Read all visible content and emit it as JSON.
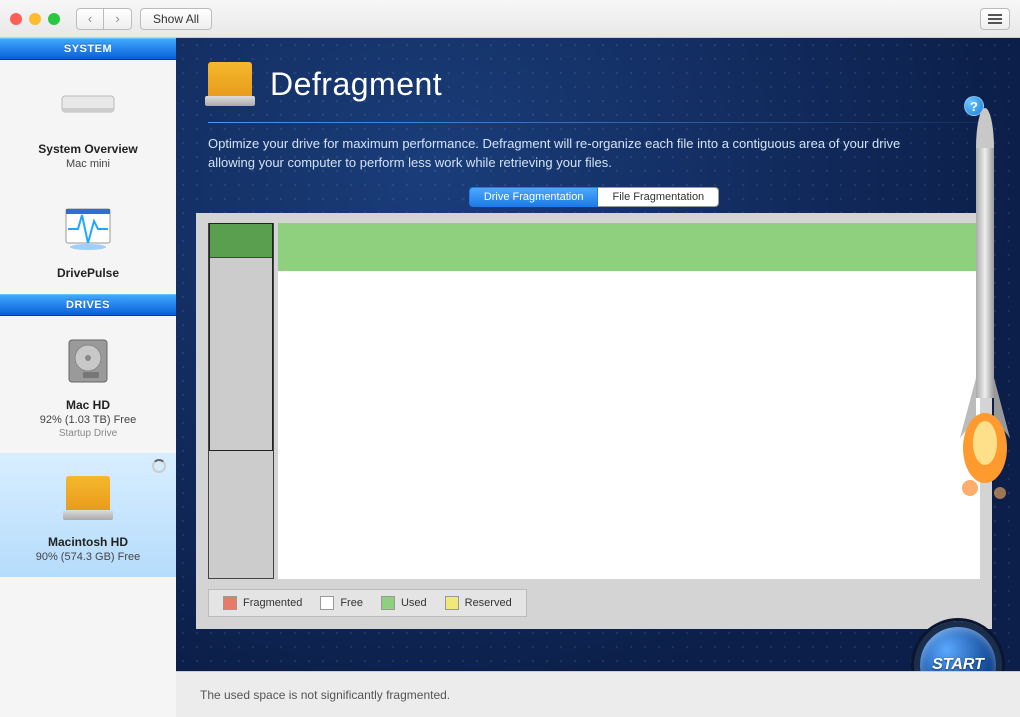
{
  "toolbar": {
    "show_all": "Show All"
  },
  "sidebar": {
    "sections": {
      "system": {
        "header": "SYSTEM"
      },
      "drives": {
        "header": "DRIVES"
      }
    },
    "items": [
      {
        "title": "System Overview",
        "sub": "Mac mini"
      },
      {
        "title": "DrivePulse",
        "sub": ""
      },
      {
        "title": "Mac HD",
        "sub": "92% (1.03 TB) Free",
        "sub2": "Startup Drive"
      },
      {
        "title": "Macintosh HD",
        "sub": "90% (574.3 GB) Free"
      }
    ]
  },
  "page": {
    "title": "Defragment",
    "description": "Optimize your drive for maximum performance. Defragment will re-organize each file into a contiguous area of your drive allowing your computer to perform less work while retrieving your files."
  },
  "tabs": [
    {
      "label": "Drive Fragmentation",
      "active": true
    },
    {
      "label": "File Fragmentation",
      "active": false
    }
  ],
  "legend": {
    "fragmented": "Fragmented",
    "free": "Free",
    "used": "Used",
    "reserved": "Reserved"
  },
  "status": "The used space is not significantly fragmented.",
  "buttons": {
    "start": "START",
    "help": "?"
  }
}
